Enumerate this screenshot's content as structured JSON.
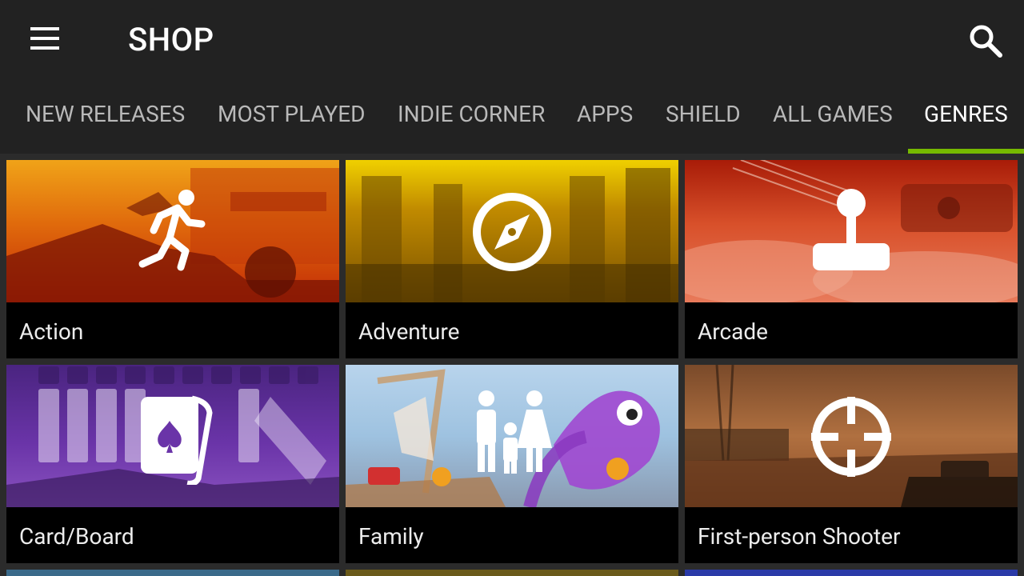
{
  "header": {
    "title": "SHOP",
    "menu_icon": "hamburger-menu-icon",
    "search_icon": "search-icon"
  },
  "tabs": [
    {
      "label": "NEW RELEASES",
      "active": false
    },
    {
      "label": "MOST PLAYED",
      "active": false
    },
    {
      "label": "INDIE CORNER",
      "active": false
    },
    {
      "label": "APPS",
      "active": false
    },
    {
      "label": "SHIELD",
      "active": false
    },
    {
      "label": "ALL GAMES",
      "active": false
    },
    {
      "label": "GENRES",
      "active": true
    }
  ],
  "colors": {
    "accent": "#76b900",
    "background": "#222222",
    "text": "#ffffff",
    "tab_inactive": "#b9b9b9"
  },
  "genres": [
    {
      "label": "Action",
      "icon": "running-person-icon",
      "tint": "#d94a00"
    },
    {
      "label": "Adventure",
      "icon": "compass-icon",
      "tint": "#b98a00"
    },
    {
      "label": "Arcade",
      "icon": "joystick-icon",
      "tint": "#c73a1e"
    },
    {
      "label": "Card/Board",
      "icon": "playing-card-icon",
      "tint": "#6a2fa3"
    },
    {
      "label": "Family",
      "icon": "family-icon",
      "tint": "#7aa3c8"
    },
    {
      "label": "First-person Shooter",
      "icon": "crosshair-icon",
      "tint": "#9a5a2c"
    }
  ]
}
